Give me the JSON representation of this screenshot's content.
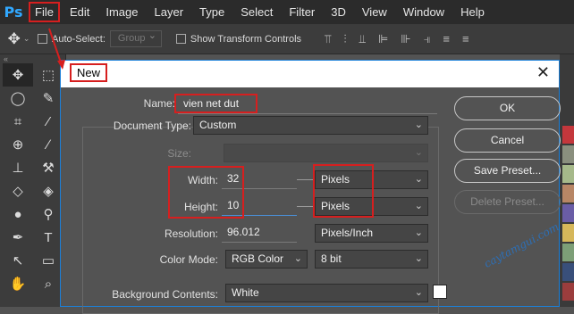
{
  "app": {
    "logo": "Ps"
  },
  "menu": [
    {
      "label": "File",
      "active": true
    },
    {
      "label": "Edit"
    },
    {
      "label": "Image"
    },
    {
      "label": "Layer"
    },
    {
      "label": "Type"
    },
    {
      "label": "Select"
    },
    {
      "label": "Filter"
    },
    {
      "label": "3D"
    },
    {
      "label": "View"
    },
    {
      "label": "Window"
    },
    {
      "label": "Help"
    }
  ],
  "options_bar": {
    "auto_select_label": "Auto-Select:",
    "auto_select_value": "Group",
    "show_transform_label": "Show Transform Controls"
  },
  "dialog": {
    "title": "New",
    "name_label": "Name:",
    "name_value": "vien net dut",
    "doc_type_label": "Document Type:",
    "doc_type_value": "Custom",
    "size_label": "Size:",
    "width_label": "Width:",
    "width_value": "32",
    "width_unit": "Pixels",
    "height_label": "Height:",
    "height_value": "10",
    "height_unit": "Pixels",
    "resolution_label": "Resolution:",
    "resolution_value": "96.012",
    "resolution_unit": "Pixels/Inch",
    "color_mode_label": "Color Mode:",
    "color_mode_value": "RGB Color",
    "color_depth_value": "8 bit",
    "bg_label": "Background Contents:",
    "bg_value": "White",
    "buttons": {
      "ok": "OK",
      "cancel": "Cancel",
      "save_preset": "Save Preset...",
      "delete_preset": "Delete Preset..."
    }
  },
  "watermark": "caytamgui.com",
  "colors": {
    "accent": "#d61f1f",
    "menubar": "#2b2b2b",
    "panel": "#3c3c3c",
    "dialog_bg": "#535353",
    "ps_blue": "#31a8ff"
  }
}
